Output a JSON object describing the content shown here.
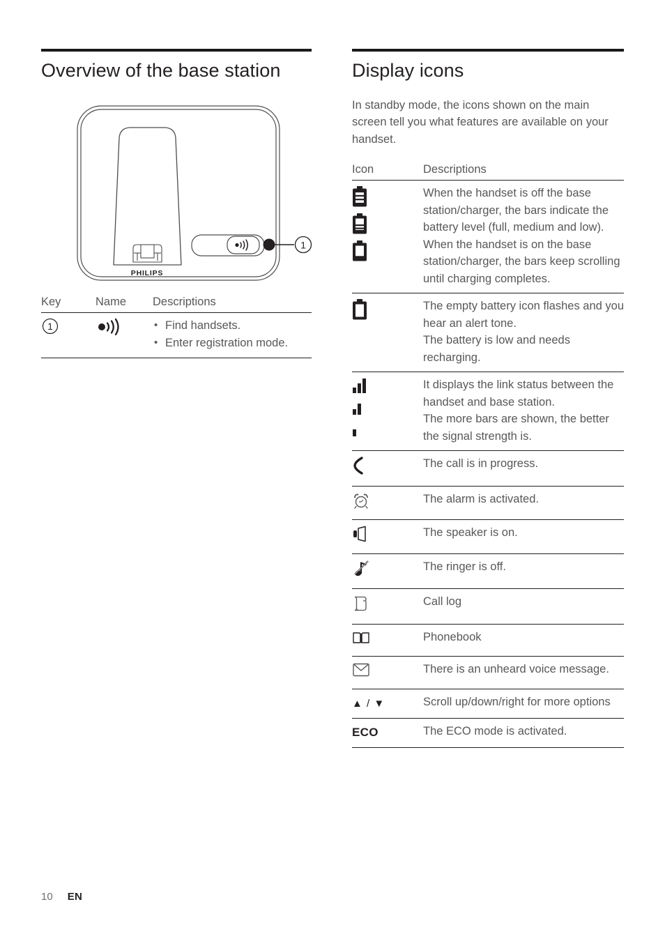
{
  "left": {
    "heading": "Overview of the base station",
    "illustration": {
      "brand": "PHILIPS",
      "callout_label": "1",
      "paging_button_icon": "paging-wave-icon"
    },
    "key_table": {
      "headers": [
        "Key",
        "Name",
        "Descriptions"
      ],
      "rows": [
        {
          "key": "1",
          "name_icon": "paging-wave-icon",
          "descriptions": [
            "Find handsets.",
            "Enter registration mode."
          ]
        }
      ]
    }
  },
  "right": {
    "heading": "Display icons",
    "intro": "In standby mode, the icons shown on the main screen tell you what features are available on your handset.",
    "icon_table": {
      "headers": [
        "Icon",
        "Descriptions"
      ],
      "rows": [
        {
          "icons": [
            "battery-full-icon",
            "battery-medium-icon",
            "battery-low-icon"
          ],
          "description": "When the handset is off the base station/charger, the bars indicate the battery level (full, medium and low).\nWhen the handset is on the base station/charger, the bars keep scrolling until charging completes."
        },
        {
          "icons": [
            "battery-empty-icon"
          ],
          "description": "The empty battery icon flashes and you hear an alert tone.\nThe battery is low and needs recharging."
        },
        {
          "icons": [
            "signal-3-bars-icon",
            "signal-2-bars-icon",
            "signal-1-bar-icon"
          ],
          "description": "It displays the link status between the handset and base station.\nThe more bars are shown, the better the signal strength is."
        },
        {
          "icons": [
            "call-in-progress-icon"
          ],
          "description": "The call is in progress."
        },
        {
          "icons": [
            "alarm-clock-icon"
          ],
          "description": "The alarm is activated."
        },
        {
          "icons": [
            "speaker-on-icon"
          ],
          "description": "The speaker is on."
        },
        {
          "icons": [
            "ringer-off-icon"
          ],
          "description": "The ringer is off."
        },
        {
          "icons": [
            "call-log-icon"
          ],
          "description": "Call log"
        },
        {
          "icons": [
            "phonebook-icon"
          ],
          "description": "Phonebook"
        },
        {
          "icons": [
            "voice-message-icon"
          ],
          "description": "There is an unheard voice message."
        },
        {
          "icons": [
            "scroll-arrows-icon"
          ],
          "icon_text": "▲ / ▼",
          "description": "Scroll up/down/right for more options"
        },
        {
          "icons": [
            "eco-text-icon"
          ],
          "icon_text": "ECO",
          "description": "The ECO mode is activated."
        }
      ]
    }
  },
  "footer": {
    "page_number": "10",
    "language": "EN"
  }
}
